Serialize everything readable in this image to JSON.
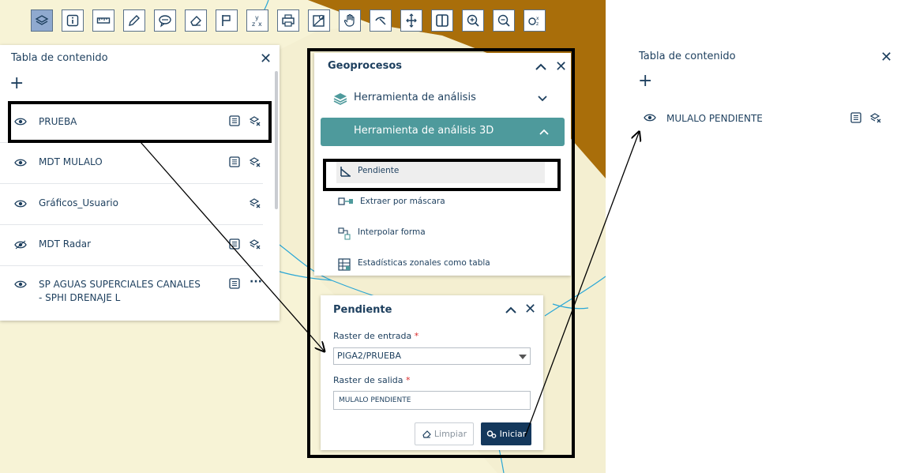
{
  "toolbar": {
    "tools": [
      {
        "icon": "layers-icon",
        "active": true
      },
      {
        "icon": "info-icon",
        "active": false
      },
      {
        "icon": "ruler-icon",
        "active": false
      },
      {
        "icon": "pencil-icon",
        "active": false
      },
      {
        "icon": "comment-icon",
        "active": false
      },
      {
        "icon": "eraser-icon",
        "active": false
      },
      {
        "icon": "flag-icon",
        "active": false
      },
      {
        "icon": "coordinates-icon",
        "active": false
      },
      {
        "icon": "print-icon",
        "active": false
      },
      {
        "icon": "map-pin-icon",
        "active": false
      },
      {
        "icon": "hand-pan-icon",
        "active": false
      },
      {
        "icon": "satellite-icon",
        "active": false
      },
      {
        "icon": "move-icon",
        "active": false
      },
      {
        "icon": "split-view-icon",
        "active": false
      },
      {
        "icon": "zoom-in-icon",
        "active": false
      },
      {
        "icon": "zoom-out-icon",
        "active": false
      },
      {
        "icon": "xyz-icon",
        "active": false
      }
    ]
  },
  "toc": {
    "title": "Tabla de contenido",
    "add_label": "+",
    "close_label": "✕",
    "layers": [
      {
        "name": "PRUEBA",
        "has_table": true,
        "action": "layers-remove-icon"
      },
      {
        "name": "MDT MULALO",
        "has_table": true,
        "action": "layers-remove-icon"
      },
      {
        "name": "Gráficos_Usuario",
        "has_table": false,
        "action": "layers-remove-icon"
      },
      {
        "name": "MDT Radar",
        "has_table": true,
        "action": "layers-remove-icon"
      },
      {
        "name": "SP AGUAS SUPERCIALES CANALES",
        "name2": "- SPHI DRENAJE L",
        "has_table": true,
        "action": "more-icon",
        "action_label": "···"
      }
    ]
  },
  "geoprocesos": {
    "title": "Geoprocesos",
    "sections": [
      {
        "label": "Herramienta de análisis",
        "open": false
      },
      {
        "label": "Herramienta de análisis 3D",
        "open": true
      }
    ],
    "tools": [
      {
        "label": "Pendiente",
        "icon": "slope-icon",
        "selected": true
      },
      {
        "label": "Extraer por máscara",
        "icon": "mask-icon",
        "selected": false
      },
      {
        "label": "Interpolar forma",
        "icon": "interpolate-icon",
        "selected": false
      },
      {
        "label": "Estadísticas zonales como tabla",
        "icon": "zonal-stats-icon",
        "selected": false
      }
    ]
  },
  "pendiente": {
    "title": "Pendiente",
    "input_label": "Raster de entrada",
    "input_value": "PIGA2/PRUEBA",
    "output_label": "Raster de salida",
    "output_value": "MULALO PENDIENTE",
    "required_mark": "*",
    "clear_label": "Limpiar",
    "run_label": "Iniciar"
  },
  "toc_result": {
    "title": "Tabla de contenido",
    "add_label": "+",
    "close_label": "✕",
    "layers": [
      {
        "name": "MULALO PENDIENTE",
        "has_table": true,
        "action": "layers-remove-icon"
      }
    ]
  },
  "colors": {
    "map_background": "#f7f3d6",
    "map_brown": "#a96e0a",
    "river": "#2aa7d6",
    "teal_section": "#4e9a9c",
    "primary_button": "#14385c",
    "text": "#1d3f5e"
  }
}
